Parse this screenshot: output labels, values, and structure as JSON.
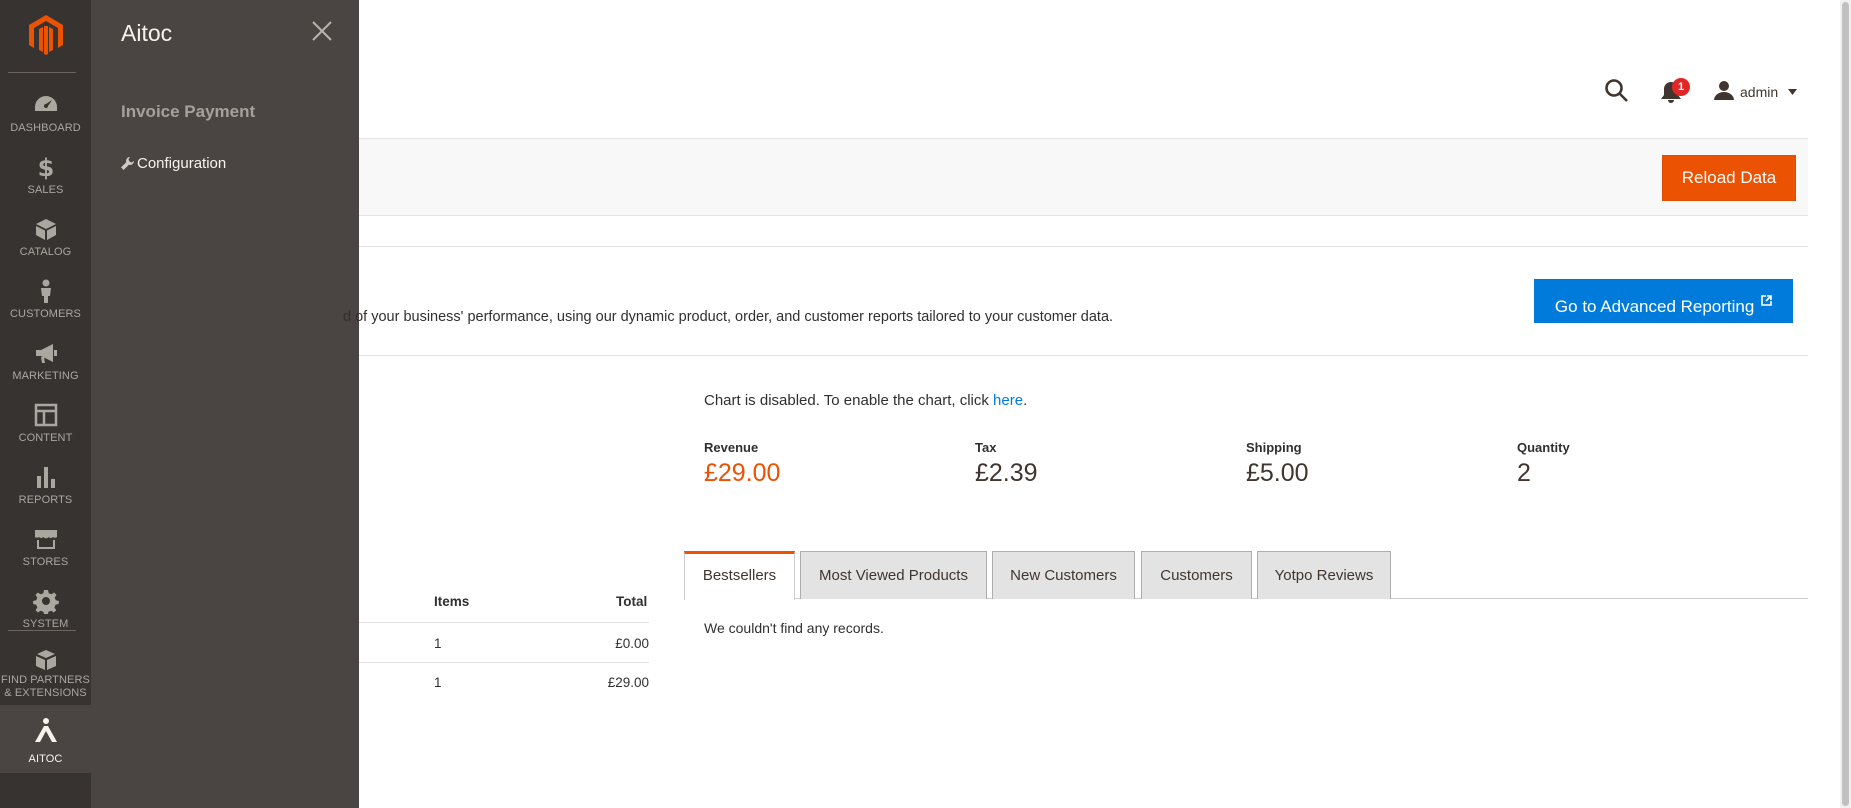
{
  "nav": {
    "items": [
      {
        "label": "DASHBOARD",
        "icon": "dashboard-icon"
      },
      {
        "label": "SALES",
        "icon": "dollar-icon"
      },
      {
        "label": "CATALOG",
        "icon": "box-icon"
      },
      {
        "label": "CUSTOMERS",
        "icon": "person-icon"
      },
      {
        "label": "MARKETING",
        "icon": "megaphone-icon"
      },
      {
        "label": "CONTENT",
        "icon": "layout-icon"
      },
      {
        "label": "REPORTS",
        "icon": "bar-chart-icon"
      },
      {
        "label": "STORES",
        "icon": "store-icon"
      },
      {
        "label": "SYSTEM",
        "icon": "gear-icon"
      },
      {
        "label_line1": "FIND PARTNERS",
        "label_line2": "& EXTENSIONS",
        "icon": "boxes-icon"
      },
      {
        "label": "AITOC",
        "icon": "aitoc-icon"
      }
    ]
  },
  "flyout": {
    "title": "Aitoc",
    "group_title": "Invoice Payment",
    "config_link": "Configuration"
  },
  "header": {
    "notification_count": "1",
    "user": "admin"
  },
  "actions": {
    "reload": "Reload Data"
  },
  "advanced": {
    "description": "d of your business' performance, using our dynamic product, order, and customer reports tailored to your customer data.",
    "button": "Go to Advanced Reporting"
  },
  "chart": {
    "message_prefix": "Chart is disabled. To enable the chart, click ",
    "link": "here",
    "message_suffix": "."
  },
  "metrics": [
    {
      "label": "Revenue",
      "value": "£29.00"
    },
    {
      "label": "Tax",
      "value": "£2.39"
    },
    {
      "label": "Shipping",
      "value": "£5.00"
    },
    {
      "label": "Quantity",
      "value": "2"
    }
  ],
  "tabs": [
    "Bestsellers",
    "Most Viewed Products",
    "New Customers",
    "Customers",
    "Yotpo Reviews"
  ],
  "tab_content": "We couldn't find any records.",
  "orders_table": {
    "headers": [
      "Items",
      "Total"
    ],
    "rows": [
      {
        "items": "1",
        "total": "£0.00"
      },
      {
        "items": "1",
        "total": "£29.00"
      }
    ]
  },
  "colors": {
    "accent": "#eb5202",
    "link": "#007bdb",
    "nav_bg": "#373330",
    "flyout_bg": "#4a4542"
  }
}
